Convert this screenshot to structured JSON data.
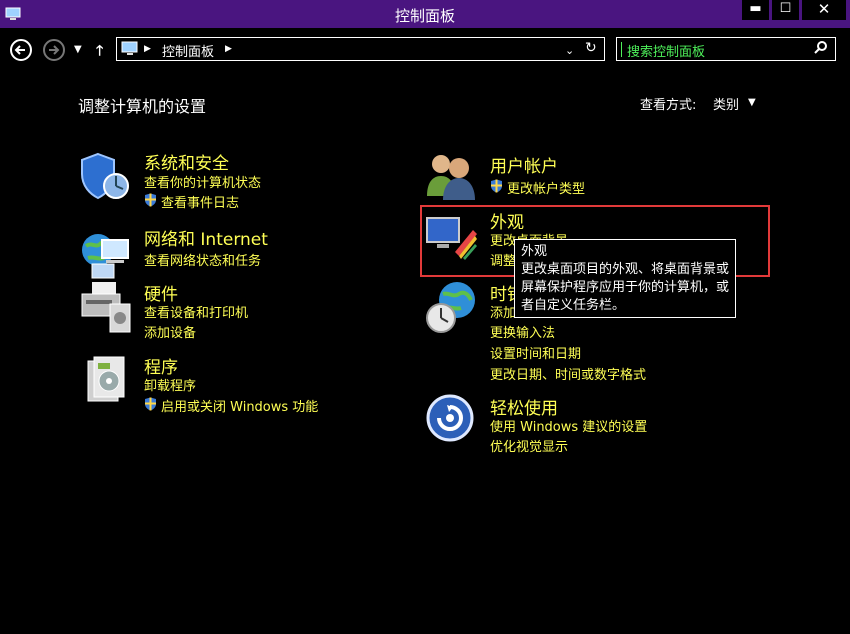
{
  "window": {
    "title": "控制面板",
    "minimize": "▬",
    "maximize": "☐",
    "close": "✕"
  },
  "nav": {
    "breadcrumb": "控制面板",
    "search_placeholder": "搜索控制面板"
  },
  "main": {
    "title": "调整计算机的设置",
    "view_by_label": "查看方式:",
    "view_by_value": "类别"
  },
  "categories": {
    "system": {
      "title": "系统和安全",
      "links": [
        "查看你的计算机状态",
        "查看事件日志"
      ]
    },
    "network": {
      "title": "网络和 Internet",
      "links": [
        "查看网络状态和任务"
      ]
    },
    "hardware": {
      "title": "硬件",
      "links": [
        "查看设备和打印机",
        "添加设备"
      ]
    },
    "programs": {
      "title": "程序",
      "links": [
        "卸载程序",
        "启用或关闭 Windows 功能"
      ]
    },
    "users": {
      "title": "用户帐户",
      "links": [
        "更改帐户类型"
      ]
    },
    "appearance": {
      "title": "外观",
      "links": [
        "更改桌面背景",
        "调整"
      ]
    },
    "clock": {
      "title": "时钟",
      "links": [
        "添加",
        "更换输入法",
        "设置时间和日期",
        "更改日期、时间或数字格式"
      ]
    },
    "ease": {
      "title": "轻松使用",
      "links": [
        "使用 Windows 建议的设置",
        "优化视觉显示"
      ]
    }
  },
  "tooltip": {
    "title": "外观",
    "lines": [
      "更改桌面项目的外观、将桌面背景或",
      "屏幕保护程序应用于你的计算机，或",
      "者自定义任务栏。"
    ]
  },
  "colors": {
    "titlebar": "#4a1580",
    "link": "#ffff55",
    "search_text": "#4ef05a",
    "highlight": "#e23a3a"
  }
}
